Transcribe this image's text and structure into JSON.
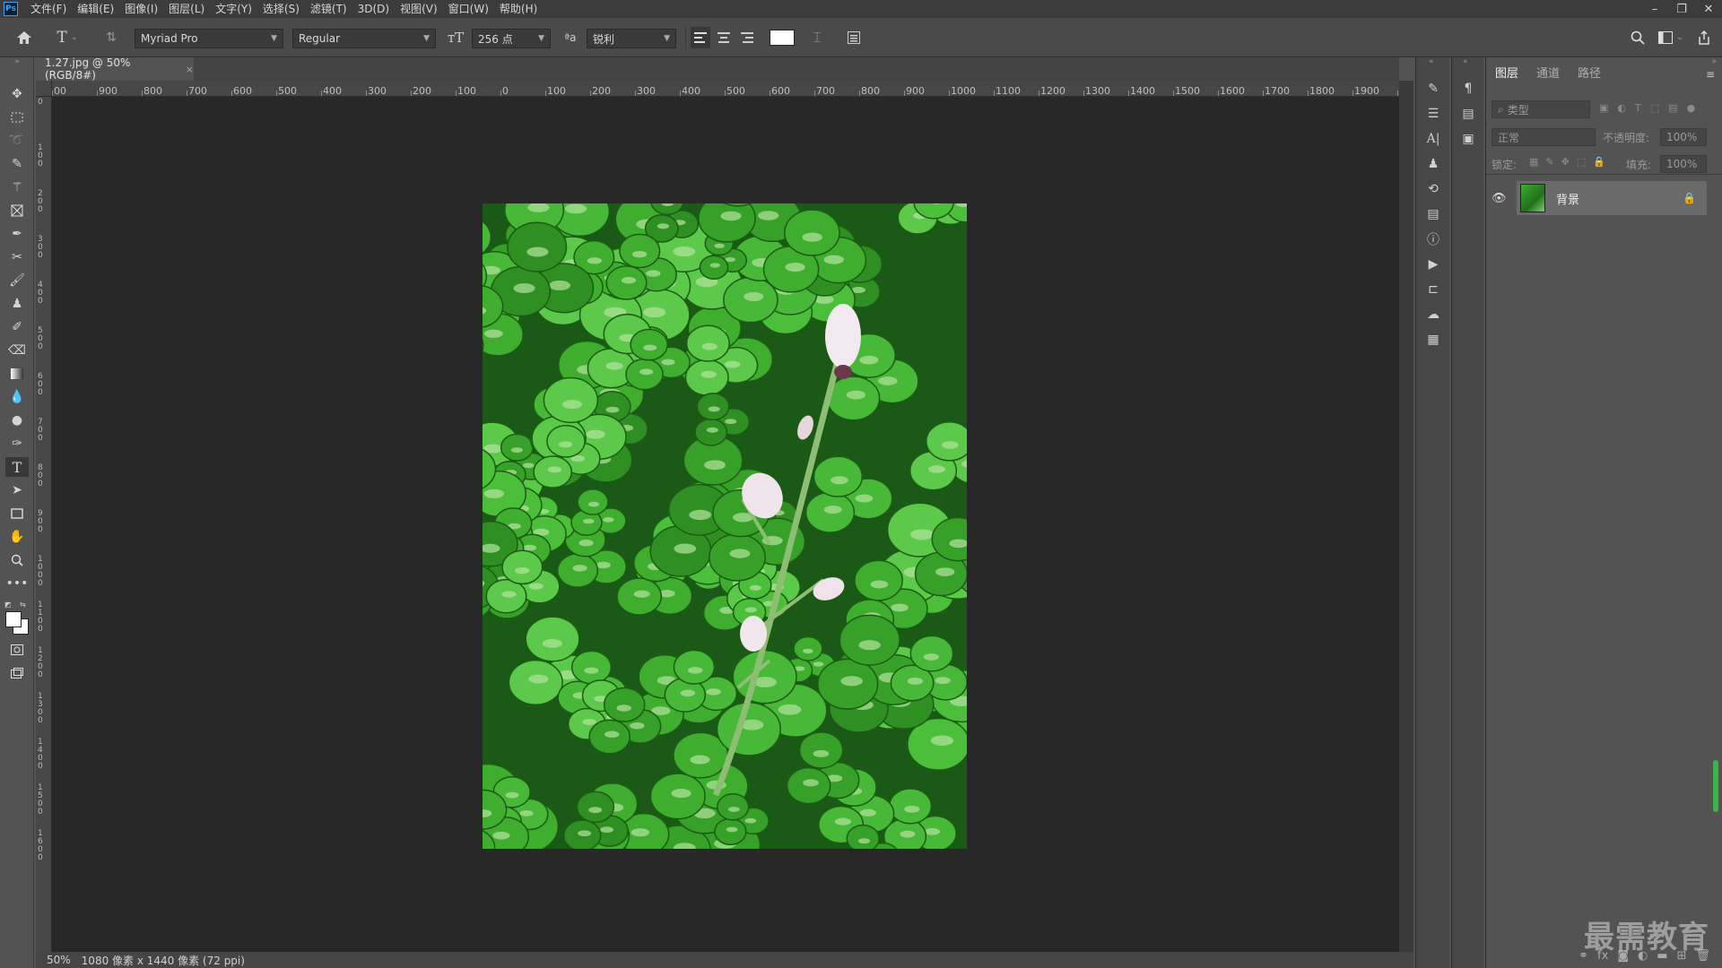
{
  "menu": {
    "logo": "Ps",
    "items": [
      "文件(F)",
      "编辑(E)",
      "图像(I)",
      "图层(L)",
      "文字(Y)",
      "选择(S)",
      "滤镜(T)",
      "3D(D)",
      "视图(V)",
      "窗口(W)",
      "帮助(H)"
    ]
  },
  "window_controls": {
    "minimize": "–",
    "restore": "❐",
    "close": "✕"
  },
  "options": {
    "font_family": "Myriad Pro",
    "font_style": "Regular",
    "font_size": "256 点",
    "antialias": "锐利",
    "aa_symbol": "ªa"
  },
  "document": {
    "tab_title": "1.27.jpg @ 50%(RGB/8#)",
    "close": "×"
  },
  "ruler": {
    "h_labels": [
      "00",
      "900",
      "800",
      "700",
      "600",
      "500",
      "400",
      "300",
      "200",
      "100",
      "0",
      "100",
      "200",
      "300",
      "400",
      "500",
      "600",
      "700",
      "800",
      "900",
      "1000",
      "1100",
      "1200",
      "1300",
      "1400",
      "1500",
      "1600",
      "1700",
      "1800",
      "1900",
      "200"
    ],
    "v_labels": [
      "0",
      "100",
      "200",
      "300",
      "400",
      "500",
      "600",
      "700",
      "800",
      "900",
      "1000",
      "1100",
      "1200",
      "1300",
      "1400",
      "1500",
      "1600"
    ]
  },
  "status": {
    "zoom": "50%",
    "info": "1080 像素 x 1440 像素 (72 ppi)"
  },
  "panel": {
    "tabs": [
      "图层",
      "通道",
      "路径"
    ],
    "filter_placeholder": "类型",
    "blend_mode": "正常",
    "opacity_label": "不透明度:",
    "opacity_value": "100%",
    "lock_label": "锁定:",
    "fill_label": "填充:",
    "fill_value": "100%",
    "layer_name": "背景"
  },
  "watermark": "最需教育",
  "colors": {
    "accent": "#31a8ff",
    "canvas": "#282828",
    "ui": "#535353"
  }
}
